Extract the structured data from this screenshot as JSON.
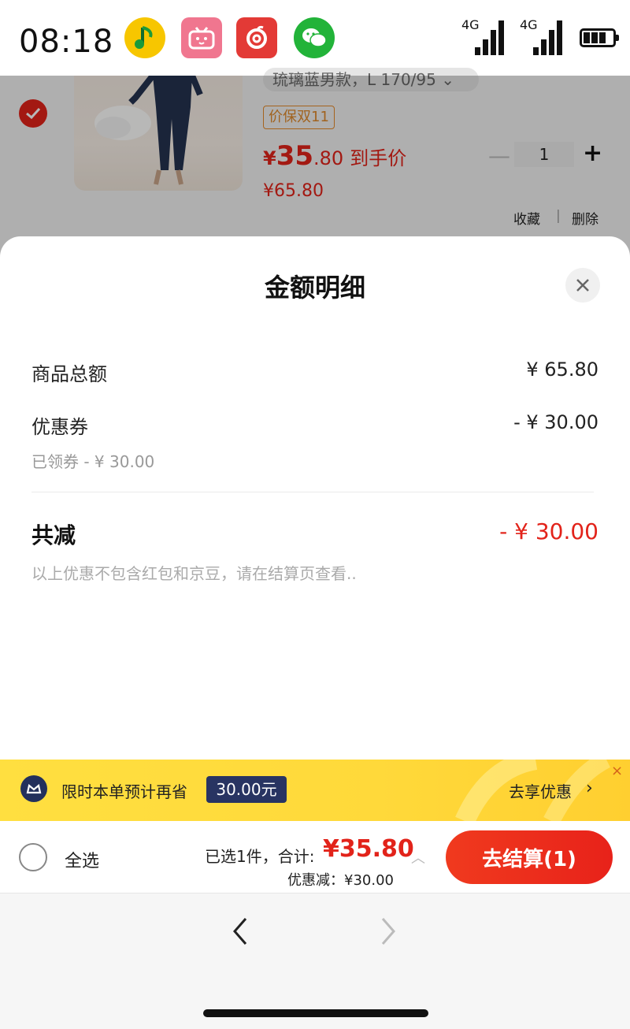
{
  "status_bar": {
    "time": "08:18",
    "apps": [
      "qq-music-icon",
      "bilibili-icon",
      "netease-music-icon",
      "wechat-icon"
    ],
    "signal1_label": "4G",
    "signal2_label": "4G"
  },
  "cart_item": {
    "spec": "琉璃蓝男款，L 170/95 ⌄",
    "tag": "价保双11",
    "price_currency": "¥",
    "price_int": "35",
    "price_dec": ".80",
    "price_suffix": "到手价",
    "original_price": "¥65.80",
    "qty_minus": "—",
    "quantity": "1",
    "qty_plus": "+",
    "favorite": "收藏",
    "separator": "|",
    "delete": "删除"
  },
  "sheet": {
    "title": "金额明细",
    "close": "×",
    "rows": {
      "goods_total_label": "商品总额",
      "goods_total_value": "¥ 65.80",
      "coupon_label": "优惠券",
      "coupon_value": "- ¥ 30.00",
      "coupon_sub": "已领券 - ¥ 30.00"
    },
    "total_label": "共减",
    "total_value": "- ¥ 30.00",
    "note": "以上优惠不包含红包和京豆，请在结算页查看.."
  },
  "promo": {
    "text": "限时本单预计再省",
    "badge": "30.00元",
    "action": "去享优惠",
    "chevron": "›",
    "close": "×"
  },
  "checkout": {
    "select_all": "全选",
    "selected": "已选1件，合计:",
    "total": "¥35.80",
    "discount": "优惠减：¥30.00",
    "caret": "︿",
    "button": "去结算(1)"
  },
  "nav": {
    "back": "‹",
    "forward": "›"
  },
  "colors": {
    "accent_red": "#e2231a",
    "promo_yellow": "#ffd93a",
    "promo_navy": "#283462"
  }
}
